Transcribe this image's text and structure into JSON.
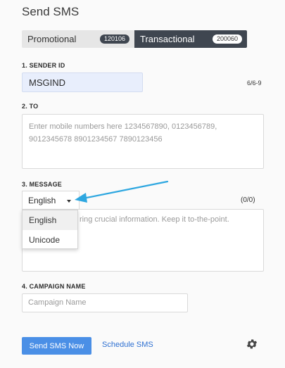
{
  "page": {
    "title": "Send SMS"
  },
  "route_toggle": {
    "options": [
      {
        "label": "Promotional",
        "count": "120106",
        "active": false
      },
      {
        "label": "Transactional",
        "count": "200060",
        "active": true
      }
    ]
  },
  "sender": {
    "label": "1. SENDER ID",
    "value": "MSGIND",
    "counter": "6/6-9"
  },
  "to": {
    "label": "2. TO",
    "placeholder": "Enter mobile numbers here 1234567890, 0123456789, 9012345678 8901234567 7890123456"
  },
  "message": {
    "label": "3. MESSAGE",
    "language_selected": "English",
    "language_options": [
      "English",
      "Unicode"
    ],
    "counter": "(0/0)",
    "placeholder_visible": "ring crucial information. Keep it to-the-point."
  },
  "campaign": {
    "label": "4. CAMPAIGN NAME",
    "placeholder": "Campaign Name"
  },
  "actions": {
    "send_label": "Send SMS Now",
    "schedule_label": "Schedule SMS"
  },
  "colors": {
    "accent": "#4a8fe6",
    "arrow": "#2ea7e0",
    "toggle_active": "#3f4650"
  },
  "icons": {
    "settings": "gear-icon",
    "dropdown": "caret-down-icon"
  }
}
